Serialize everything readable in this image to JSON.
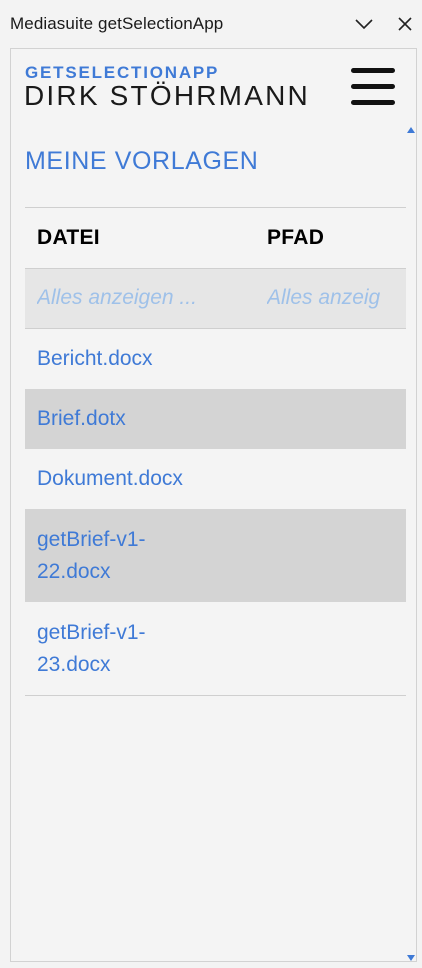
{
  "window": {
    "title": "Mediasuite getSelectionApp"
  },
  "brand": {
    "app_name": "GETSELECTIONAPP",
    "user_name": "DIRK STÖHRMANN"
  },
  "section": {
    "title": "MEINE VORLAGEN"
  },
  "table": {
    "columns": [
      "DATEI",
      "PFAD"
    ],
    "filter": {
      "file_placeholder": "Alles anzeigen ...",
      "path_placeholder": "Alles anzeigen ..."
    },
    "rows": [
      {
        "name": "Bericht.docx"
      },
      {
        "name": "Brief.dotx"
      },
      {
        "name": "Dokument.docx"
      },
      {
        "name": "getBrief-v1-22.docx"
      },
      {
        "name": "getBrief-v1-23.docx"
      }
    ]
  },
  "icons": {
    "collapse": "chevron-down-icon",
    "close": "close-icon",
    "menu": "hamburger-icon",
    "scroll_up": "triangle-up-icon",
    "scroll_down": "triangle-down-icon"
  },
  "colors": {
    "accent": "#3f7ad6",
    "placeholder": "#9fc1e9",
    "row_alt": "#d4d4d4",
    "filter_bg": "#e6e6e6"
  }
}
